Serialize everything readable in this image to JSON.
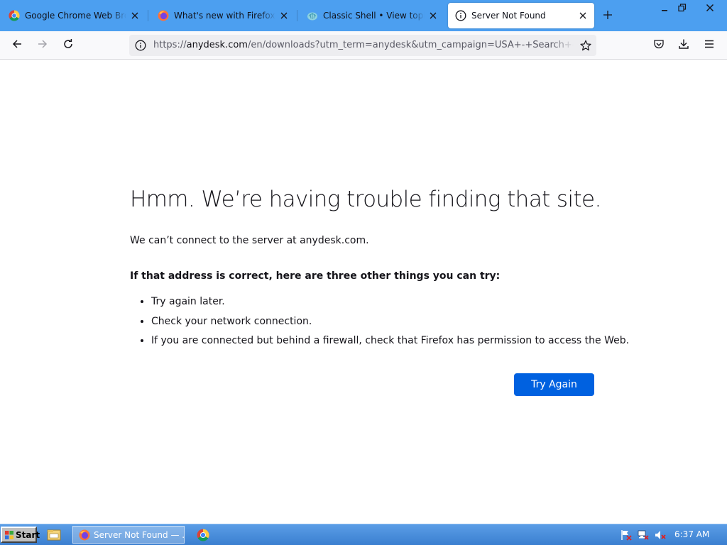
{
  "tabs": [
    {
      "title": "Google Chrome Web Browser",
      "favicon": "chrome-icon"
    },
    {
      "title": "What's new with Firefox - Mozilla",
      "favicon": "firefox-icon"
    },
    {
      "title": "Classic Shell • View topic - Windows",
      "favicon": "classic-shell-icon"
    },
    {
      "title": "Server Not Found",
      "favicon": "info-icon",
      "active": true
    }
  ],
  "urlbar": {
    "prefix": "https://",
    "host": "anydesk.com",
    "path": "/en/downloads?utm_term=anydesk&utm_campaign=USA+-+Search+-+Brand"
  },
  "error": {
    "title": "Hmm. We’re having trouble finding that site.",
    "description": "We can’t connect to the server at anydesk.com.",
    "subheading": "If that address is correct, here are three other things you can try:",
    "suggestions": [
      "Try again later.",
      "Check your network connection.",
      "If you are connected but behind a firewall, check that Firefox has permission to access the Web."
    ],
    "button_label": "Try Again"
  },
  "taskbar": {
    "start_label": "Start",
    "active_task": "Server Not Found — ...",
    "clock": "6:37 AM"
  },
  "colors": {
    "tabbar_bg": "#4c9ff0",
    "toolbar_bg": "#f9f9fb",
    "primary_button": "#0061e0",
    "taskbar_bg": "#3b7fd0"
  }
}
